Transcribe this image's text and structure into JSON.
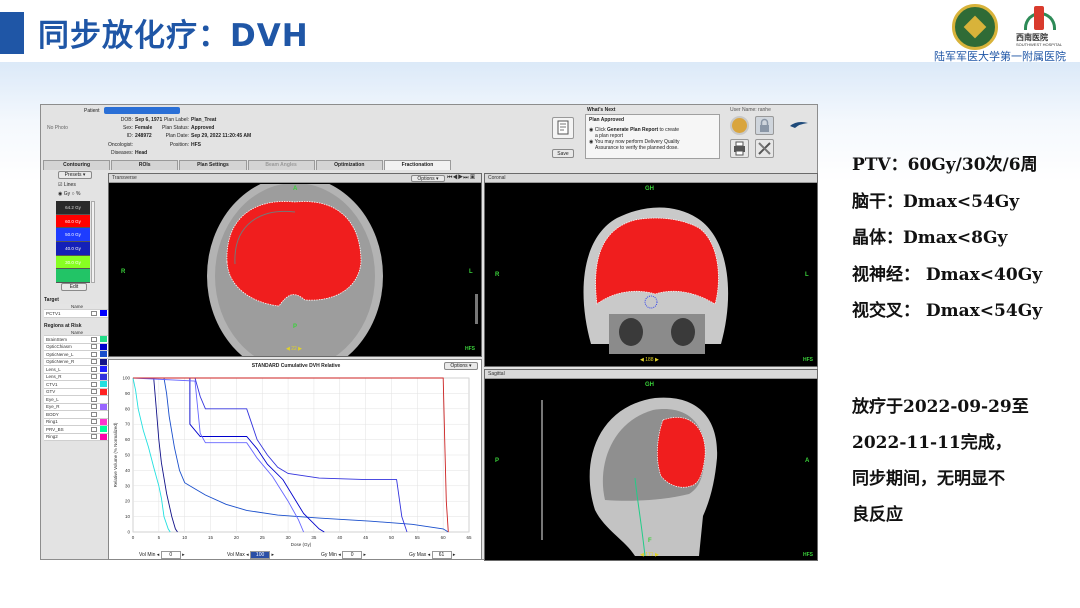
{
  "slide": {
    "title": "同步放化疗：DVH",
    "hospital": "陆军军医大学第一附属医院",
    "logo2_text": "西南医院",
    "logo2_sub": "SOUTHWEST HOSPITAL"
  },
  "patient": {
    "patient_label": "Patient",
    "no_photo": "No Photo",
    "dob_label": "DOB:",
    "dob": "Sep 6, 1971",
    "sex_label": "Sex:",
    "sex": "Female",
    "id_label": "ID:",
    "id": "248972",
    "oncologist_label": "Oncologist:",
    "diseases_label": "Diseases:",
    "diseases": "Head",
    "plan_label_label": "Plan Label:",
    "plan_label": "Plan_Treat",
    "plan_status_label": "Plan Status:",
    "plan_status": "Approved",
    "plan_date_label": "Plan Date:",
    "plan_date": "Sep 29, 2022 11:20:45 AM",
    "position_label": "Position:",
    "position": "HFS"
  },
  "whats_next": {
    "heading": "What's Next",
    "status": "Plan Approved",
    "line1_pre": "Click ",
    "line1_bold": "Generate Plan Report",
    "line1_post": " to create",
    "line1b": "a plan report",
    "line2": "You may now perform Delivery Quality",
    "line2b": "Assurance to verify the planned dose.",
    "save_label": "Save"
  },
  "user": {
    "label": "User Name: ranhe"
  },
  "tabs": [
    {
      "label": "Contouring"
    },
    {
      "label": "ROIs"
    },
    {
      "label": "Plan Settings"
    },
    {
      "label": "Beam Angles"
    },
    {
      "label": "Optimization"
    },
    {
      "label": "Fractionation"
    }
  ],
  "left": {
    "presets": "Presets ▾",
    "lines": "Lines",
    "gy": "Gy",
    "pct": "%",
    "isodose": [
      {
        "label": "64.2 Gy",
        "color": "#2a2a2a"
      },
      {
        "label": "60.0 Gy",
        "color": "#ff0000"
      },
      {
        "label": "50.0 Gy",
        "color": "#1e3cff"
      },
      {
        "label": "40.0 Gy",
        "color": "#1420b8"
      },
      {
        "label": "30.0 Gy",
        "color": "#88ff22"
      },
      {
        "label": "",
        "color": "#22c466"
      }
    ],
    "edit": "Edit",
    "target_title": "Target",
    "target_name_hdr": "Name",
    "targets": [
      {
        "name": "PCTV1",
        "color": "#0000ff"
      }
    ],
    "oar_title": "Regions at Risk",
    "oar_name_hdr": "Name",
    "oars": [
      {
        "name": "BrainStem",
        "color": "#22dd88"
      },
      {
        "name": "OpticChiasm",
        "color": "#0000cc"
      },
      {
        "name": "OpticNerve_L",
        "color": "#1a4fcc"
      },
      {
        "name": "OpticNerve_R",
        "color": "#111188"
      },
      {
        "name": "Lens_L",
        "color": "#1c1cff"
      },
      {
        "name": "Lens_R",
        "color": "#3333dd"
      },
      {
        "name": "CTV1",
        "color": "#22e0e0"
      },
      {
        "name": "GTV",
        "color": "#ff2222"
      },
      {
        "name": "Eye_L",
        "color": "#ffffff"
      },
      {
        "name": "Eye_R",
        "color": "#9966ff"
      },
      {
        "name": "BODY",
        "color": "#ffffff"
      },
      {
        "name": "Ring1",
        "color": "#ff33cc"
      },
      {
        "name": "PRV_BS",
        "color": "#00ff99"
      },
      {
        "name": "Ring2",
        "color": "#ff00aa"
      }
    ]
  },
  "views": {
    "transverse": "Transverse",
    "coronal": "Coronal",
    "sagittal": "Sagittal",
    "options": "Options ▾",
    "A": "A",
    "P": "P",
    "R": "R",
    "L": "L",
    "GH": "GH",
    "F": "F",
    "HFS": "HFS",
    "slice_t": "22",
    "slice_c": "188",
    "slice_s": "171"
  },
  "dvh": {
    "title": "STANDARD Cumulative DVH Relative",
    "options": "Options ▾",
    "vol_min_label": "Vol Min",
    "vol_min": "0",
    "vol_max_label": "Vol Max",
    "vol_max": "100",
    "gy_min_label": "Gy Min",
    "gy_min": "0",
    "gy_max_label": "Gy Max",
    "gy_max": "61"
  },
  "chart_data": {
    "type": "line",
    "title": "STANDARD Cumulative DVH Relative",
    "xlabel": "Dose (Gy)",
    "ylabel": "Relative Volume (% Normalized)",
    "xlim": [
      0,
      65
    ],
    "ylim": [
      0,
      100
    ],
    "xticks": [
      0,
      5,
      10,
      15,
      20,
      25,
      30,
      35,
      40,
      45,
      50,
      55,
      60,
      65
    ],
    "yticks": [
      0,
      10,
      20,
      30,
      40,
      50,
      60,
      70,
      80,
      90,
      100
    ],
    "series": [
      {
        "color": "#22e0e0",
        "points": [
          [
            0,
            100
          ],
          [
            0.5,
            92
          ],
          [
            1,
            80
          ],
          [
            2,
            66
          ],
          [
            3,
            55
          ],
          [
            4,
            42
          ],
          [
            5,
            30
          ],
          [
            5.5,
            22
          ],
          [
            6,
            10
          ],
          [
            6.8,
            2
          ],
          [
            7.2,
            0
          ]
        ]
      },
      {
        "color": "#111188",
        "points": [
          [
            0,
            100
          ],
          [
            4,
            100
          ],
          [
            4.5,
            80
          ],
          [
            5,
            60
          ],
          [
            5.5,
            45
          ],
          [
            6.5,
            25
          ],
          [
            7.5,
            10
          ],
          [
            8.2,
            2
          ],
          [
            8.6,
            0
          ]
        ]
      },
      {
        "color": "#1a4fcc",
        "points": [
          [
            0,
            100
          ],
          [
            6,
            100
          ],
          [
            6.5,
            90
          ],
          [
            7,
            75
          ],
          [
            8,
            55
          ],
          [
            9,
            40
          ],
          [
            10,
            32
          ],
          [
            12,
            28
          ],
          [
            14,
            24
          ],
          [
            18,
            18
          ],
          [
            22,
            14
          ],
          [
            28,
            11
          ],
          [
            36,
            9
          ],
          [
            46,
            7
          ],
          [
            54,
            5
          ],
          [
            60,
            2
          ],
          [
            61,
            0
          ]
        ]
      },
      {
        "color": "#0000cc",
        "points": [
          [
            0,
            100
          ],
          [
            11,
            100
          ],
          [
            11,
            70
          ],
          [
            13,
            62
          ],
          [
            22,
            62
          ],
          [
            24,
            54
          ],
          [
            26,
            44
          ],
          [
            29,
            34
          ],
          [
            33,
            12
          ],
          [
            36,
            2
          ],
          [
            37,
            0
          ]
        ]
      },
      {
        "color": "#3333dd",
        "points": [
          [
            0,
            100
          ],
          [
            12,
            100
          ],
          [
            13,
            88
          ],
          [
            14,
            80
          ],
          [
            22,
            80
          ],
          [
            23,
            70
          ],
          [
            24,
            60
          ],
          [
            26,
            50
          ],
          [
            28,
            42
          ],
          [
            30,
            38
          ],
          [
            36,
            35
          ],
          [
            45,
            34
          ],
          [
            51,
            34
          ],
          [
            52,
            10
          ],
          [
            53,
            0
          ]
        ]
      },
      {
        "color": "#6666ff",
        "points": [
          [
            0,
            100
          ],
          [
            12,
            98
          ],
          [
            13,
            64
          ],
          [
            14,
            58
          ],
          [
            22,
            58
          ],
          [
            24,
            48
          ],
          [
            27,
            36
          ],
          [
            30,
            20
          ],
          [
            32,
            8
          ],
          [
            33,
            0
          ]
        ]
      },
      {
        "color": "#cc2222",
        "points": [
          [
            0,
            100
          ],
          [
            60,
            100
          ],
          [
            60.3,
            60
          ],
          [
            60.6,
            20
          ],
          [
            61,
            0
          ]
        ]
      }
    ]
  }
}
